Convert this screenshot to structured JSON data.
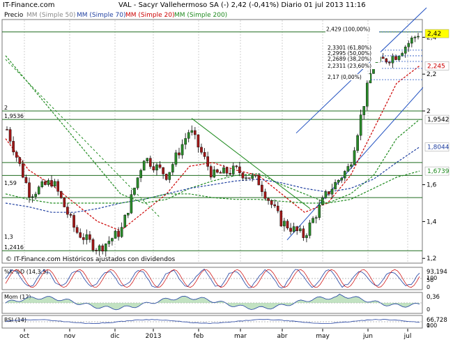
{
  "header": {
    "site": "IT-Finance.com",
    "title": "VAL - Sacyr Vallehermoso SA (-)   2,42 (-0,41%)   Diario  01 jul 2013 11:16"
  },
  "legend": {
    "price": "Precio",
    "mm50": "MM (Simple 50)",
    "mm70": "MM (Simple 70)",
    "mm20": "MM (Simple 20)",
    "mm200": "MM (Simple 200)"
  },
  "watermark": "© IT-Finance.com  Históricos ajustados con dividendos",
  "fib_labels": [
    {
      "label": "2,429 (100,00%)",
      "value": 2.429
    },
    {
      "label": "2,3301 (61,80%)",
      "value": 2.3301
    },
    {
      "label": "2,2995 (50,00%)",
      "value": 2.2995
    },
    {
      "label": "2,2689 (38,20%)",
      "value": 2.2689
    },
    {
      "label": "2,2311 (23,60%)",
      "value": 2.2311
    },
    {
      "label": "2,17 (0,00%)",
      "value": 2.17
    }
  ],
  "left_levels": [
    {
      "label": "2",
      "value": 2.0
    },
    {
      "label": "1,9536",
      "value": 1.9536
    },
    {
      "label": "1,59",
      "value": 1.59
    },
    {
      "label": "1,3",
      "value": 1.3
    },
    {
      "label": "1,2416",
      "value": 1.2416
    }
  ],
  "right_badges": [
    {
      "label": "2,42",
      "value": 2.42,
      "bg": "#ffff00",
      "color": "#000000"
    },
    {
      "label": "2,245",
      "value": 2.245,
      "bg": "#ffffff",
      "color": "#cc0000"
    },
    {
      "label": "1,9542",
      "value": 1.9542,
      "bg": "#ffffff",
      "color": "#000000"
    },
    {
      "label": "1,8044",
      "value": 1.8044,
      "bg": "#ffffff",
      "color": "#1f3fa0"
    },
    {
      "label": "1,6739",
      "value": 1.6739,
      "bg": "#ffffff",
      "color": "#1e8a1e"
    }
  ],
  "right_ticks": [
    {
      "label": "2,4",
      "value": 2.4
    },
    {
      "label": "2,2",
      "value": 2.2
    },
    {
      "label": "2",
      "value": 2.0
    },
    {
      "label": "1,6",
      "value": 1.6
    },
    {
      "label": "1,4",
      "value": 1.4
    },
    {
      "label": "1,2",
      "value": 1.2
    }
  ],
  "x_labels": [
    "oct",
    "nov",
    "dic",
    "2013",
    "feb",
    "mar",
    "abr",
    "may",
    "jun",
    "jul"
  ],
  "chart_data": {
    "type": "line",
    "title": "VAL - Sacyr Vallehermoso SA (-)",
    "ylim": [
      1.15,
      2.5
    ],
    "horizontal_levels": [
      2.429,
      2.0,
      1.9542,
      1.72,
      1.65,
      1.53,
      1.2416
    ],
    "series": [
      {
        "name": "Precio",
        "x": [
          "sep",
          "oct",
          "oct",
          "nov",
          "nov",
          "dic",
          "dic",
          "2013",
          "feb",
          "feb",
          "mar",
          "mar",
          "abr",
          "abr",
          "may",
          "may",
          "jun",
          "jun",
          "jul"
        ],
        "values": [
          1.9,
          1.55,
          1.62,
          1.35,
          1.25,
          1.35,
          1.75,
          1.65,
          1.9,
          1.65,
          1.68,
          1.62,
          1.4,
          1.32,
          1.55,
          1.7,
          2.25,
          2.3,
          2.42
        ]
      },
      {
        "name": "MM (Simple 20)",
        "values": [
          1.85,
          1.68,
          1.6,
          1.5,
          1.4,
          1.35,
          1.45,
          1.55,
          1.7,
          1.72,
          1.68,
          1.65,
          1.55,
          1.45,
          1.5,
          1.65,
          1.9,
          2.15,
          2.245
        ]
      },
      {
        "name": "MM (Simple 50)",
        "values": [
          2.3,
          2.15,
          2.0,
          1.85,
          1.7,
          1.55,
          1.5,
          1.52,
          1.58,
          1.62,
          1.65,
          1.66,
          1.6,
          1.55,
          1.5,
          1.55,
          1.65,
          1.85,
          1.9542
        ]
      },
      {
        "name": "MM (Simple 70)",
        "values": [
          1.5,
          1.48,
          1.45,
          1.45,
          1.47,
          1.5,
          1.52,
          1.55,
          1.58,
          1.6,
          1.62,
          1.63,
          1.61,
          1.58,
          1.56,
          1.58,
          1.63,
          1.72,
          1.8044
        ]
      },
      {
        "name": "MM (Simple 200)",
        "values": [
          1.55,
          1.52,
          1.5,
          1.5,
          1.5,
          1.5,
          1.52,
          1.55,
          1.55,
          1.53,
          1.52,
          1.52,
          1.51,
          1.5,
          1.5,
          1.52,
          1.58,
          1.64,
          1.6739
        ]
      }
    ]
  },
  "indicators": [
    {
      "name": "%K %D (14,3,5)",
      "value": "93,194",
      "ticks": [
        "100",
        "50",
        "0"
      ]
    },
    {
      "name": "Mom (12)",
      "value": "0,36",
      "ticks": [
        "0"
      ]
    },
    {
      "name": "RSI (14)",
      "value": "66,728",
      "ticks": [
        "100",
        "0"
      ]
    }
  ]
}
